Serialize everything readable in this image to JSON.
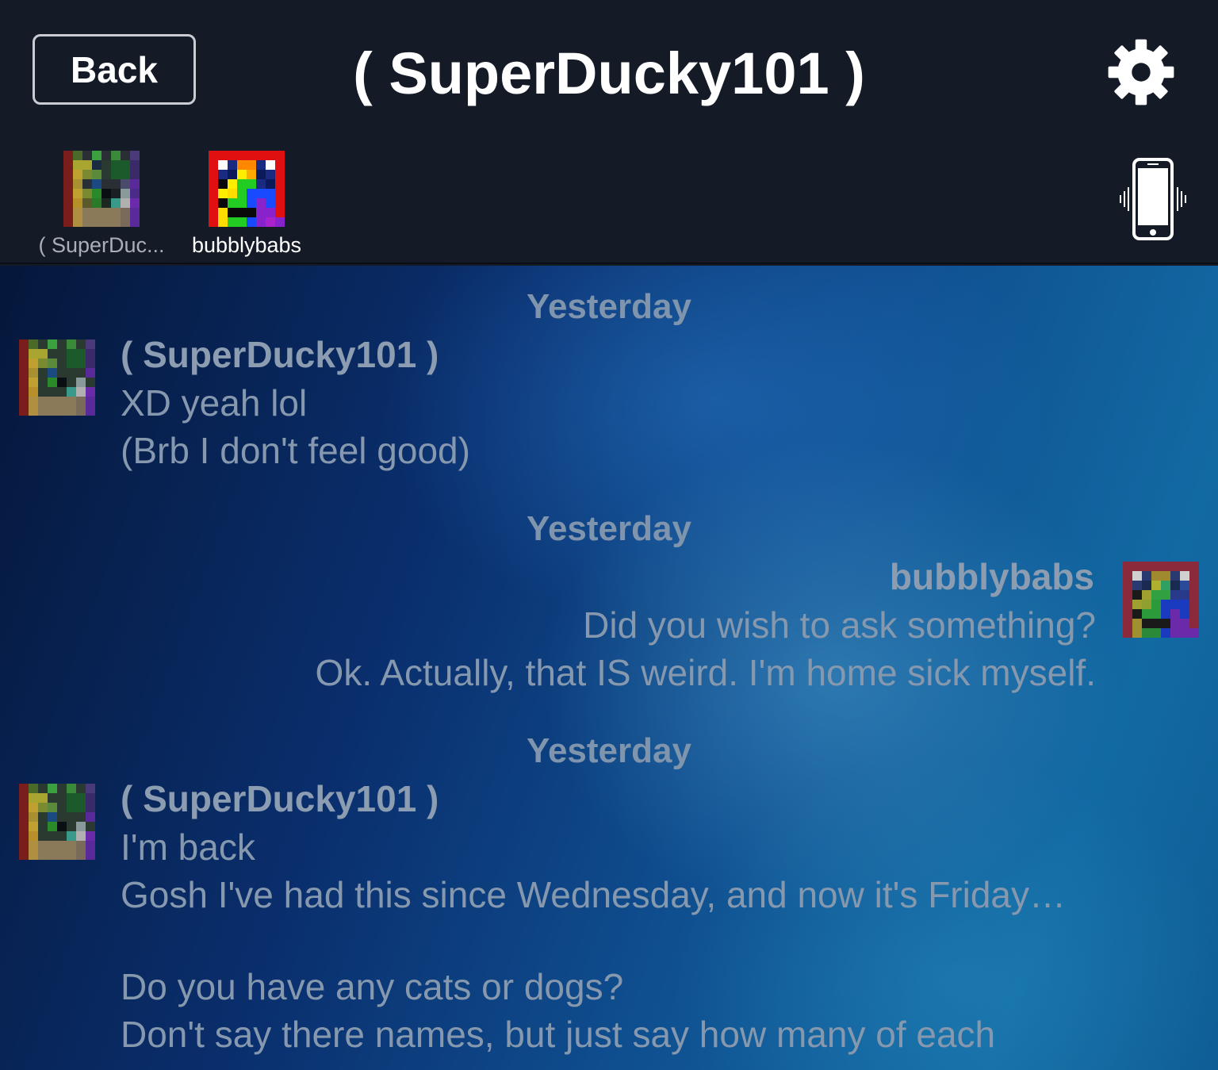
{
  "header": {
    "back_label": "Back",
    "title": "( SuperDucky101 )",
    "settings_icon": "gear-icon",
    "vibrate_icon": "phone-vibrate-icon"
  },
  "participants": [
    {
      "name": "( SuperDuc...",
      "avatar": "pixel-avatar-green"
    },
    {
      "name": "bubblybabs",
      "avatar": "pixel-avatar-rainbow"
    }
  ],
  "messages": [
    {
      "date": "Yesterday",
      "sender": "( SuperDucky101 )",
      "side": "left",
      "lines": [
        "XD yeah lol",
        "(Brb I don't feel good)"
      ]
    },
    {
      "date": "Yesterday",
      "sender": "bubblybabs",
      "side": "right",
      "lines": [
        "Did you wish to ask something?",
        "Ok.  Actually, that IS weird.  I'm home sick myself."
      ]
    },
    {
      "date": "Yesterday",
      "sender": "( SuperDucky101 )",
      "side": "left",
      "lines": [
        "I'm back",
        "Gosh I've had this since Wednesday, and now it's Friday…",
        "",
        "Do you have any cats or dogs?",
        "Don't say there names, but just say how many of each"
      ]
    }
  ],
  "colors": {
    "header_bg": "#141b26",
    "text_white": "#ffffff",
    "date_text": "#7f94ad",
    "message_text": "#8698ae"
  }
}
